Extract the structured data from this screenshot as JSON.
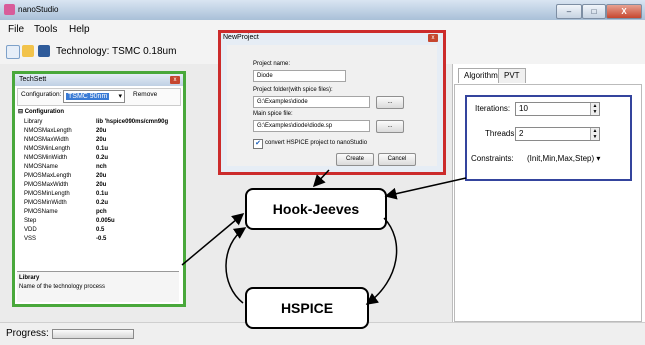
{
  "window": {
    "title": "nanoStudio",
    "controls": {
      "minimize": "–",
      "maximize": "□",
      "close": "X"
    }
  },
  "menu": [
    "File",
    "Tools",
    "Help"
  ],
  "toolbar": {
    "technology_label": "Technology:",
    "technology_value": "TSMC 0.18um"
  },
  "techsett": {
    "title": "TechSett",
    "configuration_label": "Configuration:",
    "configuration_value": "TSMC 90nm",
    "remove_label": "Remove",
    "section": "Configuration",
    "rows": [
      [
        "Library",
        "lib 'hspice090ms/cmn90g"
      ],
      [
        "NMOSMaxLength",
        "20u"
      ],
      [
        "NMOSMaxWidth",
        "20u"
      ],
      [
        "NMOSMinLength",
        "0.1u"
      ],
      [
        "NMOSMinWidth",
        "0.2u"
      ],
      [
        "NMOSName",
        "nch"
      ],
      [
        "PMOSMaxLength",
        "20u"
      ],
      [
        "PMOSMaxWidth",
        "20u"
      ],
      [
        "PMOSMinLength",
        "0.1u"
      ],
      [
        "PMOSMinWidth",
        "0.2u"
      ],
      [
        "PMOSName",
        "pch"
      ],
      [
        "Step",
        "0.005u"
      ],
      [
        "VDD",
        "0.5"
      ],
      [
        "VSS",
        "-0.5"
      ]
    ],
    "desc_title": "Library",
    "desc_text": "Name of the technology process"
  },
  "new_project": {
    "title": "NewProject",
    "name_label": "Project name:",
    "name_value": "Diode",
    "folder_label": "Project folder(with spice files):",
    "folder_value": "G:\\Examples\\diode",
    "browse1": "...",
    "main_label": "Main spice file:",
    "main_value": "G:\\Examples\\diode\\diode.sp",
    "browse2": "...",
    "convert_label": "convert HSPICE project to nanoStudio",
    "convert_checked": true,
    "create_label": "Create",
    "cancel_label": "Cancel"
  },
  "algorithm": {
    "tabs": [
      "Algorithm",
      "PVT"
    ],
    "iterations_label": "Iterations:",
    "iterations_value": "10",
    "threads_label": "Threads:",
    "threads_value": "2",
    "constraints_label": "Constraints:",
    "constraints_value": "(Init,Min,Max,Step)"
  },
  "flow": {
    "box1": "Hook-Jeeves",
    "box2": "HSPICE"
  },
  "status": {
    "progress_label": "Progress:"
  },
  "colors": {
    "techsett_border": "#49a83b",
    "newproject_border": "#cc2b2b",
    "algorithm_border": "#34449d"
  }
}
